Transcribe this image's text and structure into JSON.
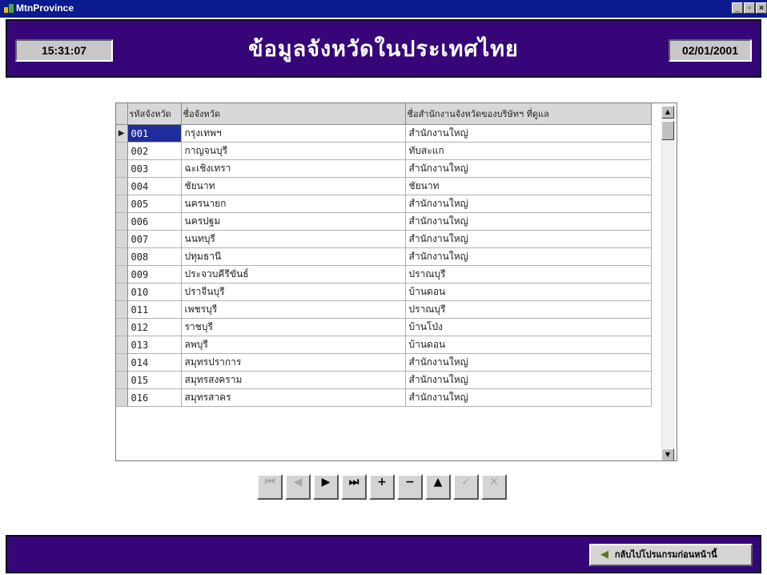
{
  "window": {
    "title": "MtnProvince",
    "controls": [
      "_",
      "▫",
      "×"
    ]
  },
  "header": {
    "time": "15:31:07",
    "title": "ข้อมูลจังหวัดในประเทศไทย",
    "date": "02/01/2001"
  },
  "grid": {
    "columns": [
      "รหัสจังหวัด",
      "ชื่อจังหวัด",
      "ชื่อสำนักงานจังหวัดของบริษัทฯ ที่ดูแล"
    ],
    "selected_row_index": 0,
    "selected_marker": "▶",
    "rows": [
      {
        "code": "001",
        "province": "กรุงเทพฯ",
        "office": "สำนักงานใหญ่"
      },
      {
        "code": "002",
        "province": "กาญจนบุรี",
        "office": "ทับสะแก"
      },
      {
        "code": "003",
        "province": "ฉะเชิงเทรา",
        "office": "สำนักงานใหญ่"
      },
      {
        "code": "004",
        "province": "ชัยนาท",
        "office": "ชัยนาท"
      },
      {
        "code": "005",
        "province": "นครนายก",
        "office": "สำนักงานใหญ่"
      },
      {
        "code": "006",
        "province": "นครปฐม",
        "office": "สำนักงานใหญ่"
      },
      {
        "code": "007",
        "province": "นนทบุรี",
        "office": "สำนักงานใหญ่"
      },
      {
        "code": "008",
        "province": "ปทุมธานี",
        "office": "สำนักงานใหญ่"
      },
      {
        "code": "009",
        "province": "ประจวบคีรีขันธ์",
        "office": "ปราณบุรี"
      },
      {
        "code": "010",
        "province": "ปราจีนบุรี",
        "office": "บ้านดอน"
      },
      {
        "code": "011",
        "province": "เพชรบุรี",
        "office": "ปราณบุรี"
      },
      {
        "code": "012",
        "province": "ราชบุรี",
        "office": "บ้านโป่ง"
      },
      {
        "code": "013",
        "province": "ลพบุรี",
        "office": "บ้านดอน"
      },
      {
        "code": "014",
        "province": "สมุทรปราการ",
        "office": "สำนักงานใหญ่"
      },
      {
        "code": "015",
        "province": "สมุทรสงคราม",
        "office": "สำนักงานใหญ่"
      },
      {
        "code": "016",
        "province": "สมุทรสาคร",
        "office": "สำนักงานใหญ่"
      }
    ],
    "scroll_up": "▲",
    "scroll_down": "▼"
  },
  "navigator": {
    "buttons": [
      {
        "name": "nav-first-button",
        "icon": "first-record-icon",
        "glyph": "⏮",
        "enabled": false
      },
      {
        "name": "nav-prior-button",
        "icon": "prior-record-icon",
        "glyph": "◀",
        "enabled": false
      },
      {
        "name": "nav-next-button",
        "icon": "next-record-icon",
        "glyph": "▶",
        "enabled": true
      },
      {
        "name": "nav-last-button",
        "icon": "last-record-icon",
        "glyph": "⏭",
        "enabled": true
      },
      {
        "name": "nav-insert-button",
        "icon": "plus-icon",
        "glyph": "+",
        "enabled": true
      },
      {
        "name": "nav-delete-button",
        "icon": "minus-icon",
        "glyph": "−",
        "enabled": true
      },
      {
        "name": "nav-edit-button",
        "icon": "edit-up-icon",
        "glyph": "▲",
        "enabled": true
      },
      {
        "name": "nav-post-button",
        "icon": "checkmark-icon",
        "glyph": "✓",
        "enabled": false
      },
      {
        "name": "nav-cancel-button",
        "icon": "cancel-x-icon",
        "glyph": "✕",
        "enabled": false
      }
    ]
  },
  "footer": {
    "back_icon": "back-arrow-icon",
    "back_glyph": "◀",
    "back_label": "กลับไปโปรแกรมก่อนหน้านี้"
  },
  "colors": {
    "titlebar": "#0b1a8e",
    "panel": "#360678",
    "selection": "#1e2d99"
  }
}
